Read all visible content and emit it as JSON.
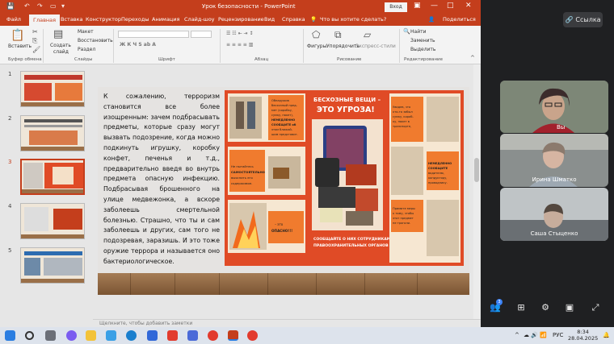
{
  "window": {
    "title": "Урок безопасности  -  PowerPoint",
    "login": "Вход"
  },
  "tabs": [
    "Файл",
    "Главная",
    "Вставка",
    "Конструктор",
    "Переходы",
    "Анимация",
    "Слайд-шоу",
    "Рецензирование",
    "Вид",
    "Справка"
  ],
  "tellme": "Что вы хотите сделать?",
  "share": "Поделиться",
  "ribbon": {
    "paste": "Вставить",
    "create": "Создать",
    "slide": "слайд",
    "layout": "Макет",
    "restore": "Восстановить",
    "section": "Раздел",
    "shapes": "Фигуры",
    "arrange": "Упорядочить",
    "quick_styles": "Экспресс-стили",
    "find": "Найти",
    "replace": "Заменить",
    "select": "Выделить",
    "groups": [
      "Буфер обмена",
      "Слайды",
      "Шрифт",
      "Абзац",
      "Рисование",
      "Редактирование"
    ]
  },
  "slides": {
    "numbers": [
      "1",
      "2",
      "3",
      "4",
      "5"
    ],
    "selected_index": 3
  },
  "slide": {
    "body": "К сожалению, терроризм становится все более изощренным: зачем подбрасывать предметы, которые сразу могут вызвать подозрение, когда можно подкинуть игрушку, коробку конфет, печенья и т.д., предварительно введя во внутрь предмета опасную инфекцию. Подбрасывая брошенного на улице медвежонка, а вскоре заболеешь смертельной болезнью. Страшно, что ты и сам заболеешь и других, сам того не подозревая, заразишь. И это тоже оружие террора и называется оно бактериологическое.",
    "poster": {
      "title1": "БЕСХОЗНЫЕ ВЕЩИ –",
      "title2": "ЭТО УГРОЗА!",
      "bottom": "СООБЩАЙТЕ О НИХ СОТРУДНИКАМ ПРАВООХРАНИТЕЛЬНЫХ ОРГАНОВ",
      "left_text1": "Обнаружив бесхозный предмет (коробку, сумку, пакет), НЕМЕДЛЕННО СООБЩИТЕ об этом ближайшим представителям силовых структур.",
      "left_text2": "Не пытайтесь САМОСТОЯТЕЛЬНО выяснить его содержимое.",
      "left_text3": "– ЭТО ОПАСНО!!!",
      "right_text1": "Увидев, что кто-то забыл сумку, коробку, пакет в транспорте,",
      "right_text2": "НЕМЕДЛЕННО СООБЩИТЕ водителю, кондуктору, проводнику.",
      "right_text3": "Примите меры к тому, чтобы этот предмет не трогали."
    }
  },
  "notes_placeholder": "Щелкните, чтобы добавить заметки",
  "conference": {
    "link_button": "Ссылка",
    "participants": [
      {
        "name": "Вы"
      },
      {
        "name": "Ирина Шматко"
      },
      {
        "name": "Саша Стыценко"
      }
    ],
    "badge": "3"
  },
  "taskbar": {
    "lang": "РУС",
    "time": "8:34",
    "date": "28.04.2025"
  },
  "colors": {
    "accent": "#c43e1c",
    "poster_red": "#e04b26",
    "poster_orange": "#f07b2e"
  }
}
